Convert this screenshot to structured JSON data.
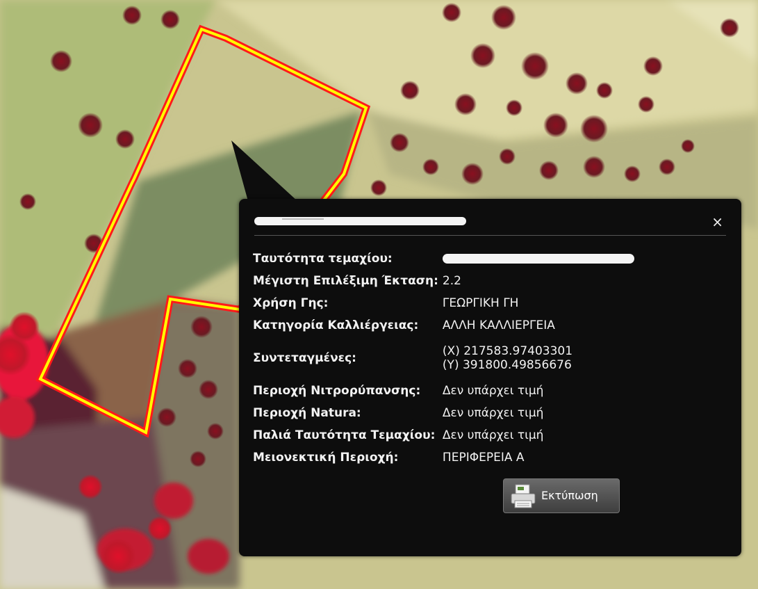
{
  "map": {
    "layer": "satellite-imagery"
  },
  "popup": {
    "title": "",
    "close_label": "×",
    "attributes": [
      {
        "label": "Ταυτότητα τεμαχίου:",
        "value": "",
        "redacted": true
      },
      {
        "label": "Μέγιστη Επιλέξιμη Έκταση:",
        "value": "2.2"
      },
      {
        "label": "Χρήση Γης:",
        "value": "ΓΕΩΡΓΙΚΗ ΓΗ"
      },
      {
        "label": "Κατηγορία Καλλιέργειας:",
        "value": "ΑΛΛΗ ΚΑΛΛΙΕΡΓΕΙΑ"
      },
      {
        "label": "Συντεταγμένες:",
        "value_x": "(X) 217583.97403301",
        "value_y": "(Y) 391800.49856676"
      },
      {
        "label": "Περιοχή Νιτρορύπανσης:",
        "value": "Δεν υπάρχει τιμή"
      },
      {
        "label": "Περιοχή Natura:",
        "value": "Δεν υπάρχει τιμή"
      },
      {
        "label": "Παλιά Ταυτότητα Τεμαχίου:",
        "value": "Δεν υπάρχει τιμή"
      },
      {
        "label": "Μειονεκτική Περιοχή:",
        "value": "ΠΕΡΙΦΕΡΕΙΑ Α"
      }
    ],
    "print_button": {
      "label": "Εκτύπωση",
      "icon": "printer-icon"
    }
  },
  "colors": {
    "parcel_outer": "#ff1a1a",
    "parcel_inner": "#ffff00",
    "popup_bg": "#0d0d0d"
  }
}
